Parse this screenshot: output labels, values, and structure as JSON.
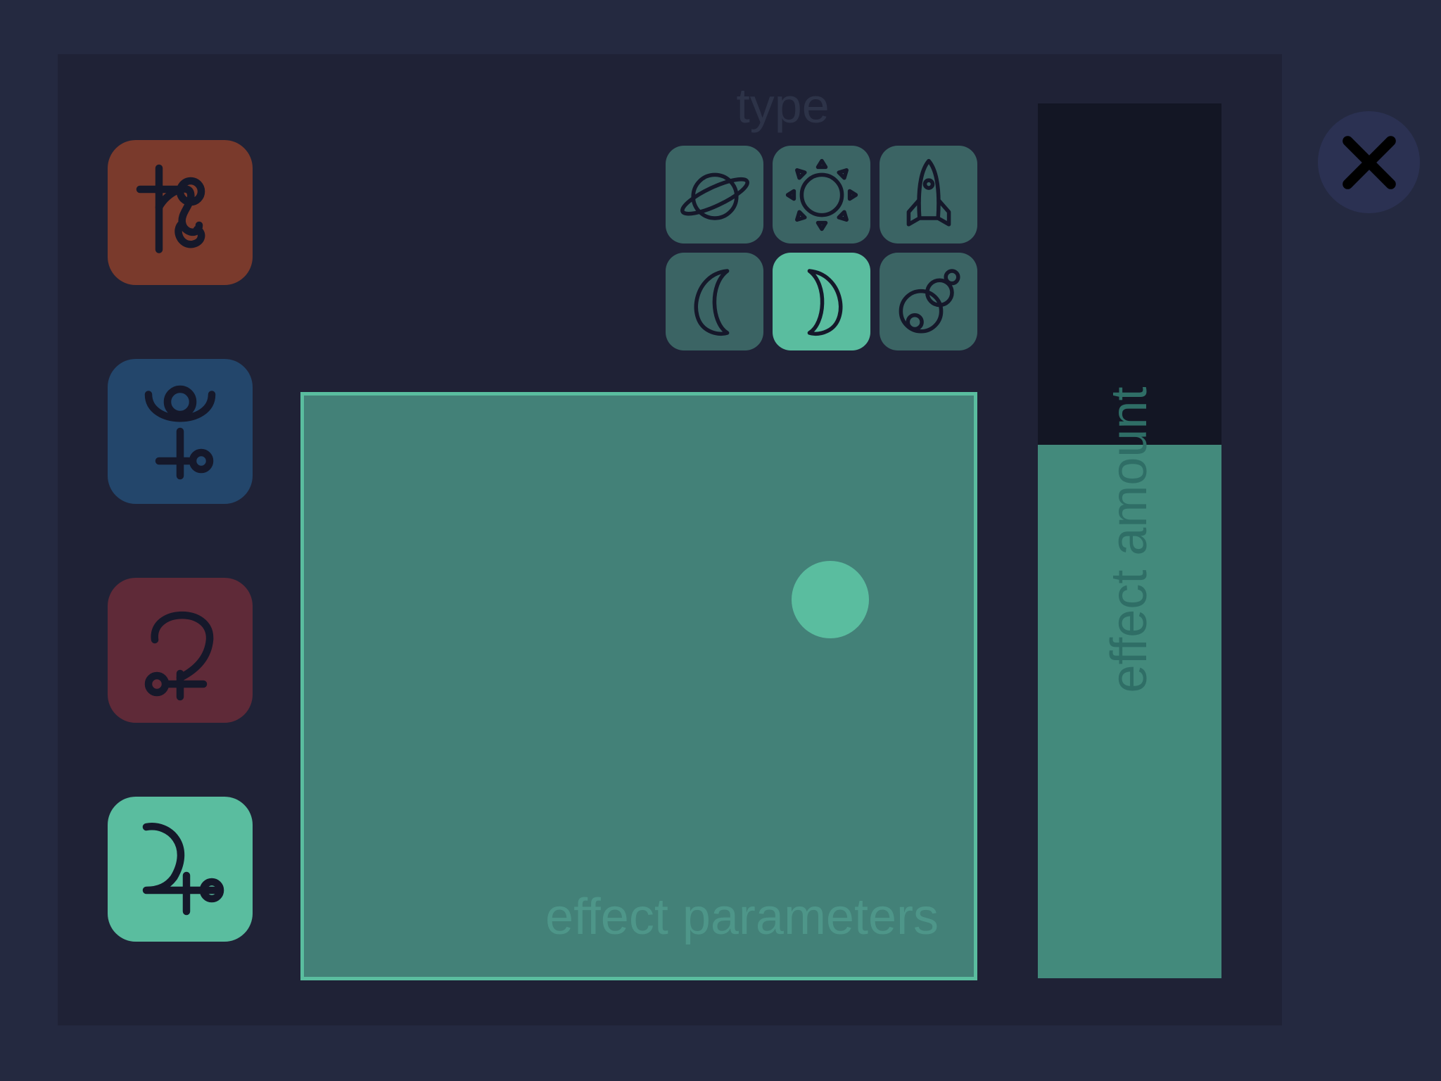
{
  "colors": {
    "background": "#242940",
    "panel": "#1f2236",
    "accent": "#5abd9f",
    "pad": "#438178",
    "icon_stroke": "#15182a"
  },
  "planets": [
    {
      "name": "saturn-icon",
      "color": "#7a3a2c",
      "selected": false
    },
    {
      "name": "pluto-icon",
      "color": "#23466b",
      "selected": false
    },
    {
      "name": "ceres-icon",
      "color": "#5f2a38",
      "selected": false
    },
    {
      "name": "jupiter-icon",
      "color": "#5abd9f",
      "selected": true
    }
  ],
  "type_section": {
    "label": "type",
    "options": [
      {
        "name": "planet-ring-icon",
        "selected": false
      },
      {
        "name": "sun-icon",
        "selected": false
      },
      {
        "name": "rocket-icon",
        "selected": false
      },
      {
        "name": "waning-moon-icon",
        "selected": false
      },
      {
        "name": "waxing-moon-icon",
        "selected": true
      },
      {
        "name": "space-station-icon",
        "selected": false
      }
    ]
  },
  "effect_parameters": {
    "label": "effect parameters",
    "handle_x": 0.79,
    "handle_y": 0.35
  },
  "effect_amount": {
    "label": "effect amount",
    "value": 0.61
  },
  "close": {
    "icon": "close-icon"
  }
}
